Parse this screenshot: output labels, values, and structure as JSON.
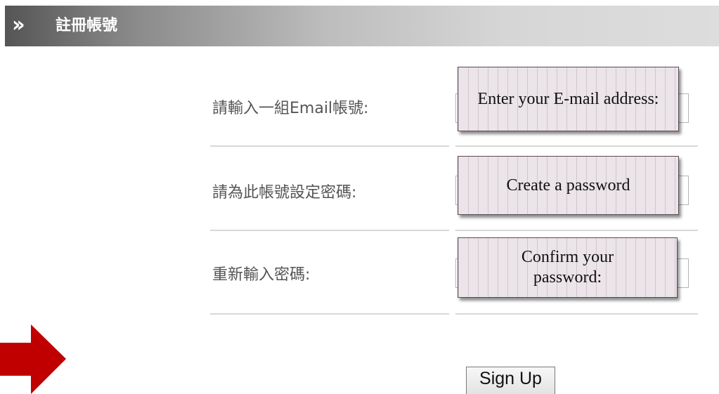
{
  "header": {
    "icon": "double-chevron-right-icon",
    "title": "註冊帳號"
  },
  "form": {
    "rows": [
      {
        "label": "請輸入一組Email帳號:",
        "tooltip": "Enter your E-mail address:"
      },
      {
        "label": "請為此帳號設定密碼:",
        "tooltip": "Create a password"
      },
      {
        "label": "重新輸入密碼:",
        "tooltip": "Confirm your password:"
      }
    ],
    "submit_label": "Sign Up"
  },
  "colors": {
    "arrow": "#c00000",
    "tooltip_bg": "#ebe4e9",
    "tooltip_border": "#5a4a55"
  }
}
